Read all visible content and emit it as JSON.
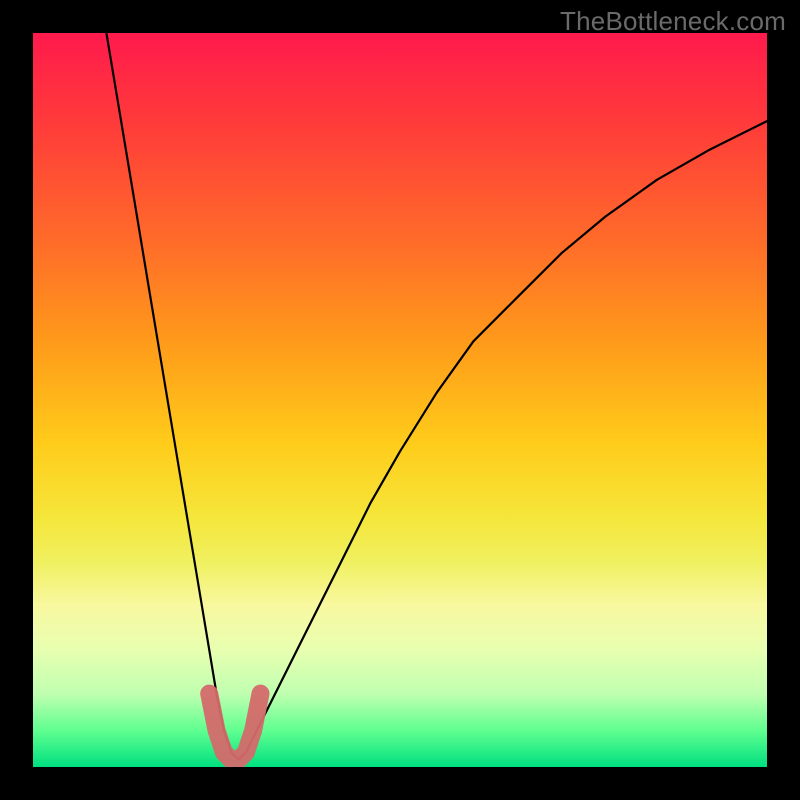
{
  "watermark": "TheBottleneck.com",
  "chart_data": {
    "type": "line",
    "title": "",
    "xlabel": "",
    "ylabel": "",
    "xlim": [
      0,
      100
    ],
    "ylim": [
      0,
      100
    ],
    "series": [
      {
        "name": "bottleneck-curve",
        "x": [
          10,
          12,
          14,
          16,
          18,
          20,
          22,
          24,
          25,
          26,
          27,
          28,
          29,
          30,
          32,
          35,
          38,
          42,
          46,
          50,
          55,
          60,
          66,
          72,
          78,
          85,
          92,
          100
        ],
        "values": [
          100,
          88,
          76,
          64,
          52,
          40,
          28,
          16,
          10,
          5,
          2,
          1,
          2,
          4,
          8,
          14,
          20,
          28,
          36,
          43,
          51,
          58,
          64,
          70,
          75,
          80,
          84,
          88
        ]
      }
    ],
    "highlight": {
      "name": "optimal-zone",
      "x": [
        24,
        25,
        26,
        27,
        28,
        29,
        30,
        31
      ],
      "values": [
        10,
        5,
        2,
        1,
        1,
        2,
        5,
        10
      ],
      "color": "#d46a6a"
    }
  }
}
